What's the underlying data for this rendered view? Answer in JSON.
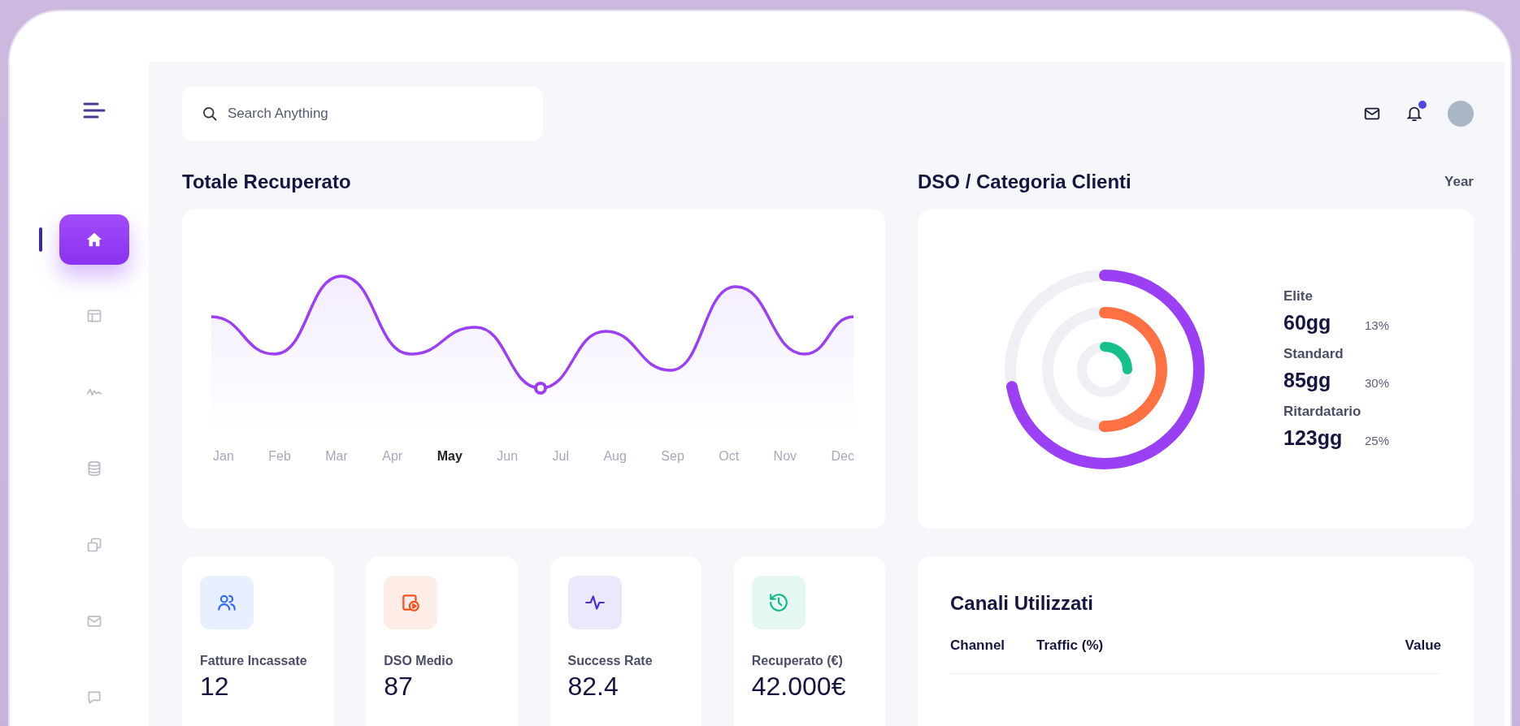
{
  "search": {
    "placeholder": "Search Anything"
  },
  "sidebar": {
    "items": [
      {
        "kind": "home",
        "selected": true
      },
      {
        "kind": "layout",
        "selected": false
      },
      {
        "kind": "activity",
        "selected": false
      },
      {
        "kind": "database",
        "selected": false
      },
      {
        "kind": "windows",
        "selected": false
      },
      {
        "kind": "mail",
        "selected": false
      },
      {
        "kind": "chat",
        "selected": false
      }
    ]
  },
  "header": {
    "notifications_badge": true
  },
  "revenue": {
    "title": "Totale Recuperato",
    "months": [
      {
        "label": "Jan",
        "selected": false
      },
      {
        "label": "Feb",
        "selected": false
      },
      {
        "label": "Mar",
        "selected": false
      },
      {
        "label": "Apr",
        "selected": false
      },
      {
        "label": "May",
        "selected": true
      },
      {
        "label": "Jun",
        "selected": false
      },
      {
        "label": "Jul",
        "selected": false
      },
      {
        "label": "Aug",
        "selected": false
      },
      {
        "label": "Sep",
        "selected": false
      },
      {
        "label": "Oct",
        "selected": false
      },
      {
        "label": "Nov",
        "selected": false
      },
      {
        "label": "Dec",
        "selected": false
      }
    ]
  },
  "dso": {
    "title": "DSO / Categoria Clienti",
    "period": "Year",
    "rings": [
      {
        "level": 0.72,
        "color": "#9b3ff5"
      },
      {
        "level": 0.5,
        "color": "#ff7043"
      },
      {
        "level": 0.25,
        "color": "#16c08b"
      }
    ],
    "legend": [
      {
        "label": "Elite",
        "value": "60gg",
        "share": "13%"
      },
      {
        "label": "Standard",
        "value": "85gg",
        "share": "30%"
      },
      {
        "label": "Ritardatario",
        "value": "123gg",
        "share": "25%"
      }
    ]
  },
  "stats": [
    {
      "kind": "people",
      "label": "Fatture Incassate",
      "value": "12",
      "color": "#2f6bff"
    },
    {
      "kind": "calendar",
      "label": "DSO Medio",
      "value": "87",
      "color": "#f4511e"
    },
    {
      "kind": "pulse",
      "label": "Success Rate",
      "value": "82.4",
      "color": "#4a2fd8"
    },
    {
      "kind": "history",
      "label": "Recuperato (€)",
      "value": "42.000€",
      "color": "#14b886"
    }
  ],
  "channels": {
    "title": "Canali Utilizzati",
    "columns": [
      "Channel",
      "Traffic (%)",
      "Value"
    ]
  }
}
